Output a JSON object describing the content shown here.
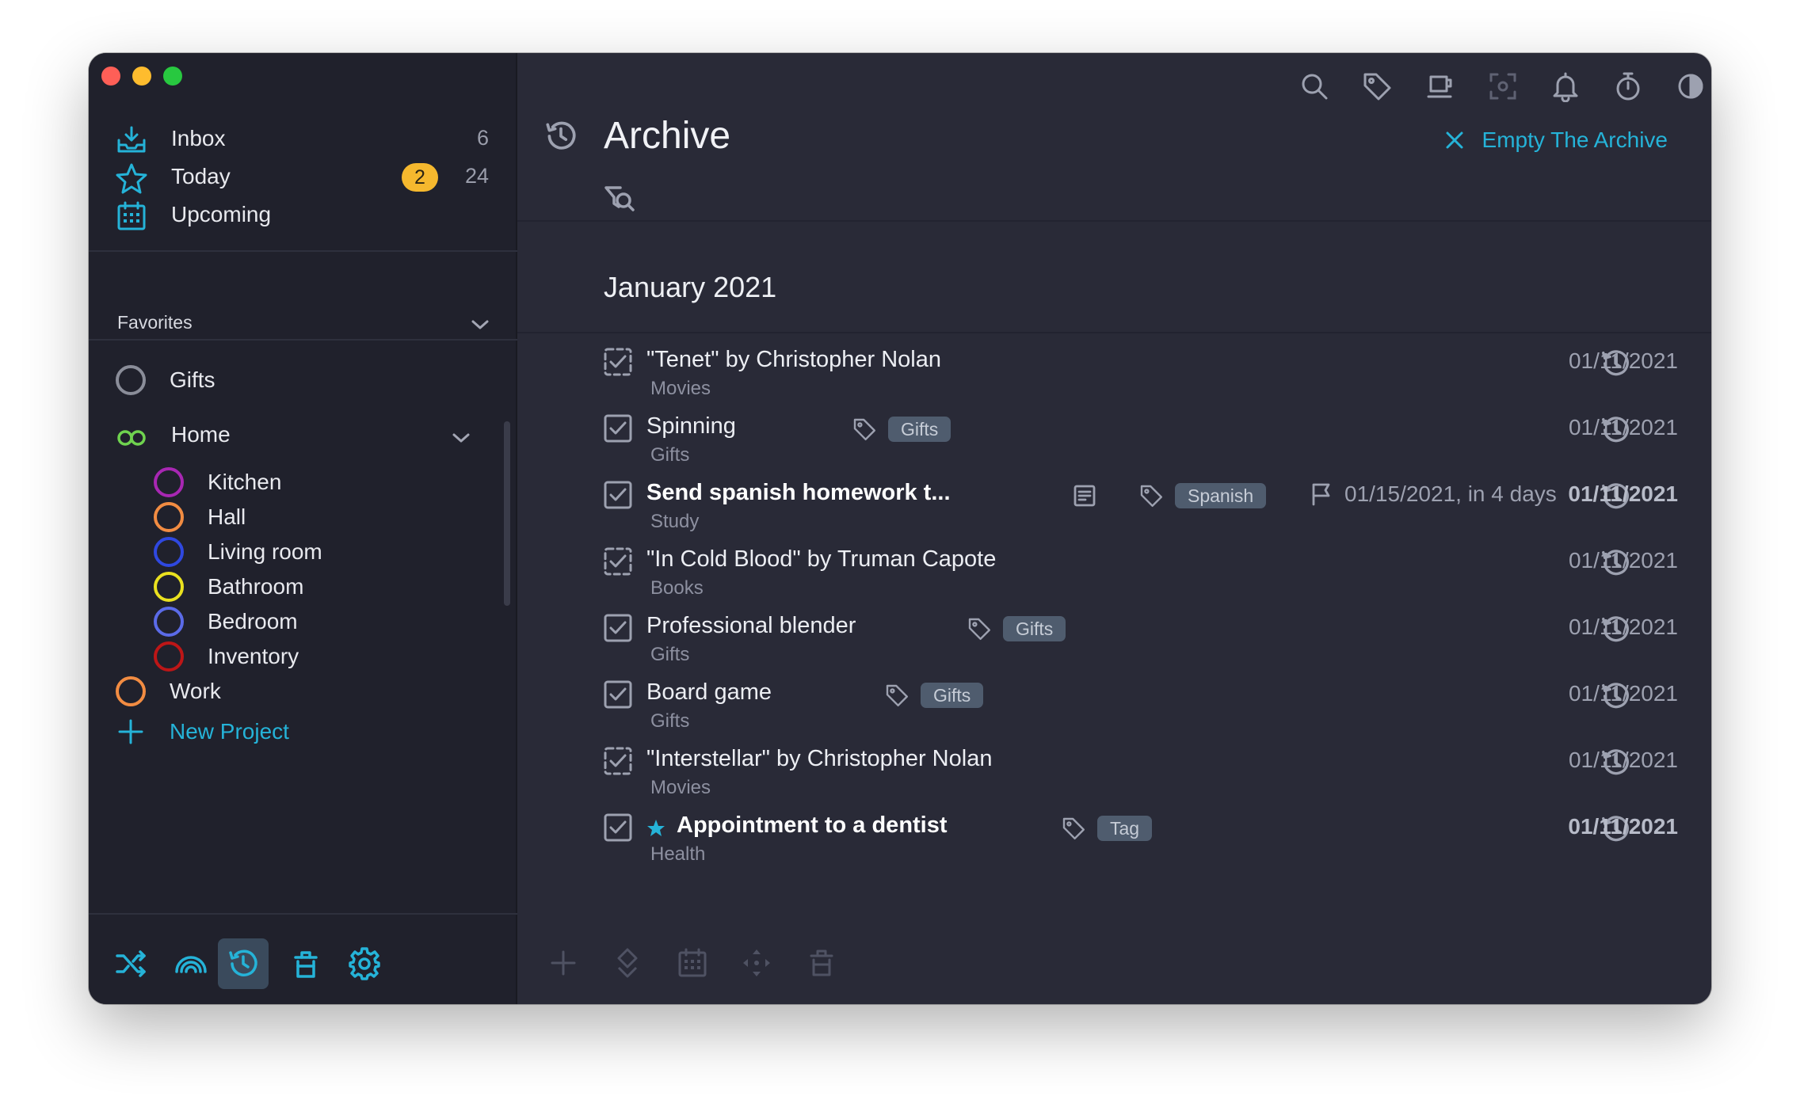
{
  "sidebar": {
    "nav": [
      {
        "label": "Inbox",
        "count": "6",
        "icon": "inbox-icon"
      },
      {
        "label": "Today",
        "badge": "2",
        "count": "24",
        "icon": "star-icon"
      },
      {
        "label": "Upcoming",
        "icon": "calendar-icon"
      }
    ],
    "favorites": {
      "title": "Favorites",
      "items": [
        {
          "label": "Gifts",
          "color": "#8a8d99"
        }
      ]
    },
    "area": {
      "label": "Home",
      "icon": "infinity-icon",
      "color": "#6fd34f",
      "projects": [
        {
          "label": "Kitchen",
          "color": "#a827b3"
        },
        {
          "label": "Hall",
          "color": "#f28c42"
        },
        {
          "label": "Living room",
          "color": "#2f48e0"
        },
        {
          "label": "Bathroom",
          "color": "#eae11f"
        },
        {
          "label": "Bedroom",
          "color": "#5b6be8"
        },
        {
          "label": "Inventory",
          "color": "#bd1617"
        }
      ]
    },
    "work": {
      "label": "Work",
      "color": "#f28c42"
    },
    "new_project": "New Project",
    "bottom_buttons": [
      "shuffle-icon",
      "rainbow-icon",
      "archive-history-icon",
      "trash-icon",
      "gear-icon"
    ],
    "active_bottom": "archive-history-icon"
  },
  "toolbar": {
    "icons": [
      "search-icon",
      "tag-icon",
      "coffee-icon",
      "focus-icon",
      "bell-icon",
      "stopwatch-icon",
      "contrast-icon",
      "windows-icon"
    ]
  },
  "main": {
    "title": "Archive",
    "empty_archive_label": "Empty The Archive",
    "month": "January 2021",
    "accent": "#25b3d8",
    "rows": [
      {
        "name": "\"Tenet\" by Christopher Nolan",
        "sub": "Movies",
        "date": "01/11/2021",
        "dashed": true
      },
      {
        "name": "Spinning",
        "sub": "Gifts",
        "tag": "Gifts",
        "date": "01/11/2021"
      },
      {
        "name": "Send spanish homework t...",
        "sub": "Study",
        "tag": "Spanish",
        "note": true,
        "due": "01/15/2021, in 4 days",
        "date": "01/11/2021",
        "bold": true
      },
      {
        "name": "\"In Cold Blood\" by Truman Capote",
        "sub": "Books",
        "date": "01/11/2021",
        "dashed": true
      },
      {
        "name": "Professional blender",
        "sub": "Gifts",
        "tag": "Gifts",
        "date": "01/11/2021"
      },
      {
        "name": "Board game",
        "sub": "Gifts",
        "tag": "Gifts",
        "date": "01/11/2021"
      },
      {
        "name": "\"Interstellar\" by Christopher Nolan",
        "sub": "Movies",
        "date": "01/11/2021",
        "dashed": true
      },
      {
        "name": "Appointment to a dentist",
        "sub": "Health",
        "tag": "Tag",
        "starred": true,
        "date": "01/11/2021",
        "bold": true
      }
    ],
    "bottom_tools": [
      "add-icon",
      "move-icon",
      "calendar-icon",
      "drag-icon",
      "trash-icon"
    ],
    "sync_icon": "cloud-icon"
  }
}
